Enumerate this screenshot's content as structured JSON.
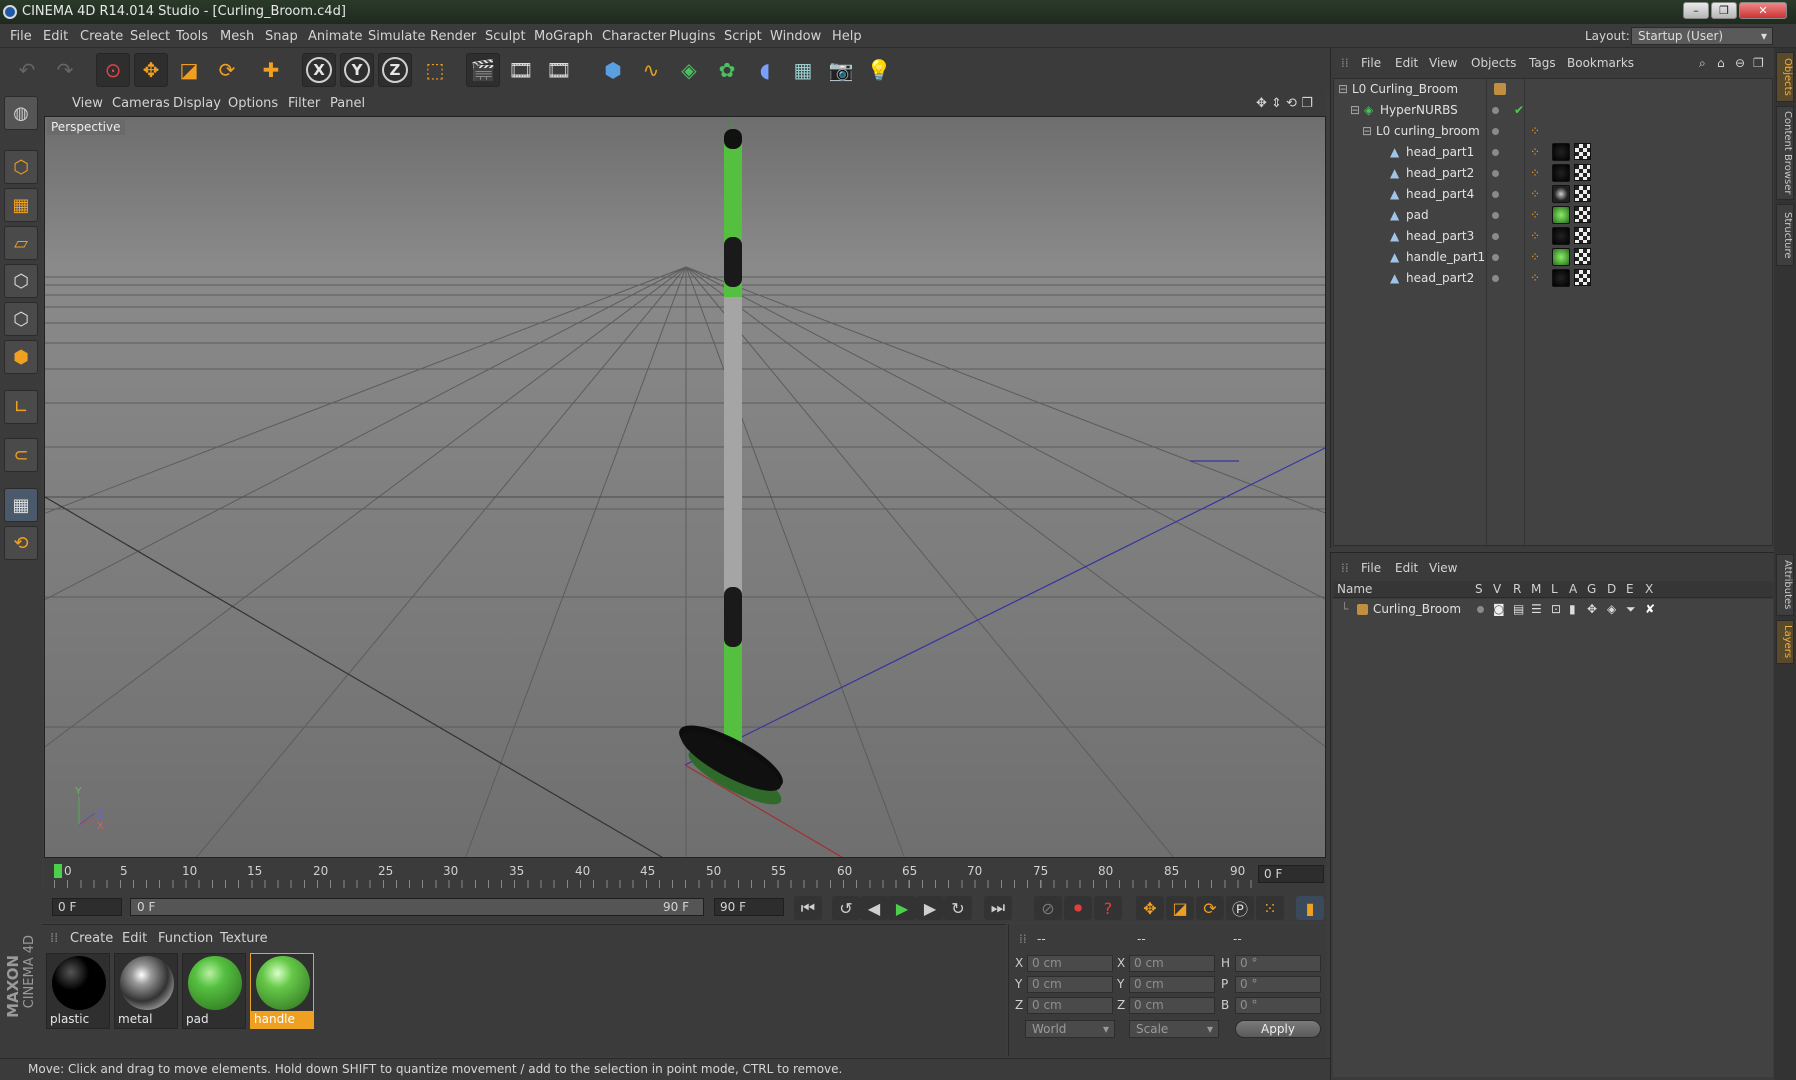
{
  "window": {
    "title": "CINEMA 4D R14.014 Studio - [Curling_Broom.c4d]"
  },
  "menu": [
    "File",
    "Edit",
    "Create",
    "Select",
    "Tools",
    "Mesh",
    "Snap",
    "Animate",
    "Simulate",
    "Render",
    "Sculpt",
    "MoGraph",
    "Character",
    "Plugins",
    "Script",
    "Window",
    "Help"
  ],
  "layout": {
    "label": "Layout:",
    "value": "Startup (User)"
  },
  "toolbar": {
    "axis_x": "X",
    "axis_y": "Y",
    "axis_z": "Z"
  },
  "viewport": {
    "menu": [
      "View",
      "Cameras",
      "Display",
      "Options",
      "Filter",
      "Panel"
    ],
    "camera_label": "Perspective"
  },
  "timeline": {
    "ticks": [
      "0",
      "5",
      "10",
      "15",
      "20",
      "25",
      "30",
      "35",
      "40",
      "45",
      "50",
      "55",
      "60",
      "65",
      "70",
      "75",
      "80",
      "85",
      "90"
    ],
    "current_frame": "0 F"
  },
  "playback": {
    "start": "0 F",
    "range_start": "0 F",
    "range_end": "90 F",
    "end": "90 F"
  },
  "materials": {
    "menu": [
      "Create",
      "Edit",
      "Function",
      "Texture"
    ],
    "items": [
      {
        "name": "plastic"
      },
      {
        "name": "metal"
      },
      {
        "name": "pad"
      },
      {
        "name": "handle"
      }
    ],
    "brand_top": "CINEMA 4D",
    "brand_bottom": "MAXON"
  },
  "coords": {
    "headers": [
      "--",
      "--",
      "--"
    ],
    "rows": [
      {
        "pl": "X",
        "pv": "0 cm",
        "sl": "X",
        "sv": "0 cm",
        "rl": "H",
        "rv": "0 °"
      },
      {
        "pl": "Y",
        "pv": "0 cm",
        "sl": "Y",
        "sv": "0 cm",
        "rl": "P",
        "rv": "0 °"
      },
      {
        "pl": "Z",
        "pv": "0 cm",
        "sl": "Z",
        "sv": "0 cm",
        "rl": "B",
        "rv": "0 °"
      }
    ],
    "mode1": "World",
    "mode2": "Scale",
    "apply": "Apply"
  },
  "status": "Move: Click and drag to move elements. Hold down SHIFT to quantize movement / add to the selection in point mode, CTRL to remove.",
  "object_manager": {
    "menu": [
      "File",
      "Edit",
      "View",
      "Objects",
      "Tags",
      "Bookmarks"
    ],
    "objects": [
      {
        "name": "Curling_Broom",
        "depth": 0
      },
      {
        "name": "HyperNURBS",
        "depth": 1
      },
      {
        "name": "curling_broom",
        "depth": 2
      },
      {
        "name": "head_part1",
        "depth": 3
      },
      {
        "name": "head_part2",
        "depth": 3
      },
      {
        "name": "head_part4",
        "depth": 3
      },
      {
        "name": "pad",
        "depth": 3
      },
      {
        "name": "head_part3",
        "depth": 3
      },
      {
        "name": "handle_part1",
        "depth": 3
      },
      {
        "name": "head_part2",
        "depth": 3
      }
    ]
  },
  "layer_manager": {
    "menu": [
      "File",
      "Edit",
      "View"
    ],
    "columns": [
      "Name",
      "S",
      "V",
      "R",
      "M",
      "L",
      "A",
      "G",
      "D",
      "E",
      "X"
    ],
    "layers": [
      {
        "name": "Curling_Broom"
      }
    ]
  },
  "right_tabs": [
    "Objects",
    "Content Browser",
    "Structure",
    "Attributes",
    "Layers"
  ],
  "colors": {
    "accent": "#f0a020",
    "green": "#55c040",
    "bg": "#3b3b3b"
  }
}
